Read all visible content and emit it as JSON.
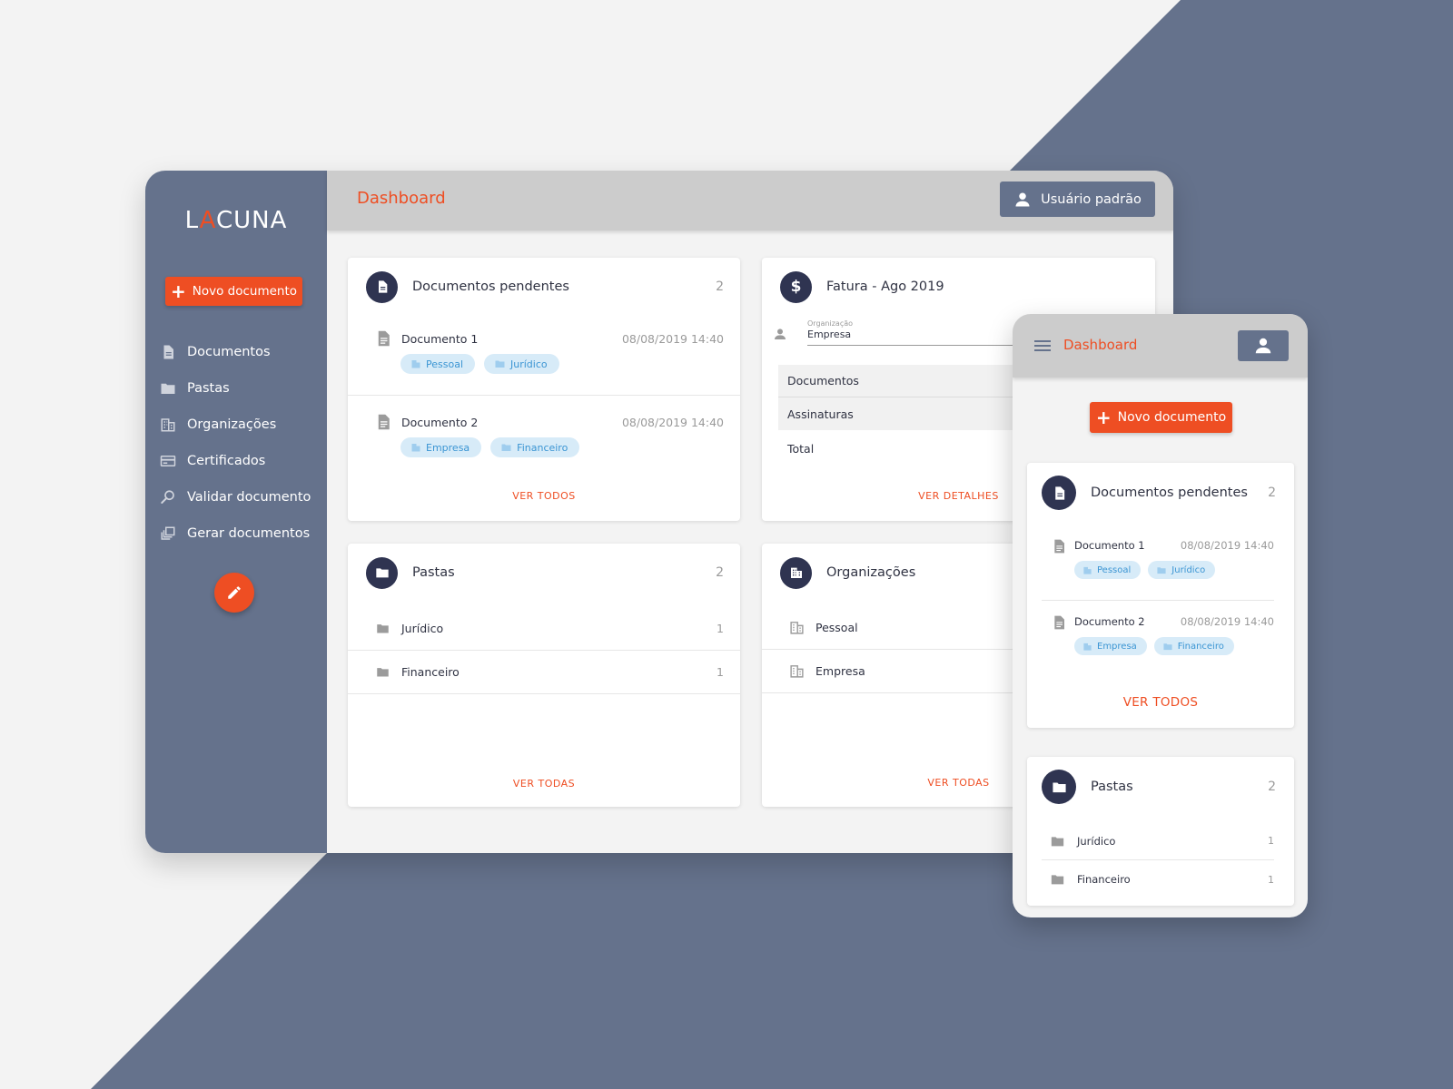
{
  "app": {
    "logo_prefix": "L",
    "logo_mark": "A",
    "logo_suffix": "CUNA"
  },
  "colors": {
    "accent": "#ee4e23",
    "sidebar": "#65728c",
    "dark_circle": "#2f3451",
    "chip_bg": "#d7ebf8",
    "chip_text": "#3b95d3",
    "page_bg": "#f3f3f3"
  },
  "sidebar": {
    "new_button": "Novo documento",
    "items": [
      {
        "label": "Documentos",
        "icon": "file-icon"
      },
      {
        "label": "Pastas",
        "icon": "folder-icon"
      },
      {
        "label": "Organizações",
        "icon": "building-icon"
      },
      {
        "label": "Certificados",
        "icon": "card-icon"
      },
      {
        "label": "Validar documento",
        "icon": "search-icon"
      },
      {
        "label": "Gerar documentos",
        "icon": "stack-icon"
      }
    ],
    "fab_icon": "pencil-icon"
  },
  "header": {
    "title": "Dashboard",
    "user_label": "Usuário padrão"
  },
  "pending": {
    "title": "Documentos pendentes",
    "count": "2",
    "link": "VER TODOS",
    "docs": [
      {
        "name": "Documento 1",
        "date": "08/08/2019 14:40",
        "chips": [
          {
            "label": "Pessoal",
            "icon": "building-icon"
          },
          {
            "label": "Jurídico",
            "icon": "folder-icon"
          }
        ]
      },
      {
        "name": "Documento 2",
        "date": "08/08/2019 14:40",
        "chips": [
          {
            "label": "Empresa",
            "icon": "building-icon"
          },
          {
            "label": "Financeiro",
            "icon": "folder-icon"
          }
        ]
      }
    ]
  },
  "invoice": {
    "title": "Fatura - Ago 2019",
    "org_label": "Organização",
    "org_value": "Empresa",
    "rows": [
      "Documentos",
      "Assinaturas",
      "Total"
    ],
    "link": "VER DETALHES"
  },
  "folders": {
    "title": "Pastas",
    "count": "2",
    "link": "VER TODAS",
    "items": [
      {
        "label": "Jurídico",
        "count": "1"
      },
      {
        "label": "Financeiro",
        "count": "1"
      }
    ]
  },
  "orgs": {
    "title": "Organizações",
    "link": "VER TODAS",
    "items": [
      {
        "label": "Pessoal"
      },
      {
        "label": "Empresa"
      }
    ]
  },
  "mobile": {
    "title": "Dashboard",
    "new_button": "Novo documento",
    "pending": {
      "title": "Documentos pendentes",
      "count": "2",
      "link": "VER TODOS",
      "docs": [
        {
          "name": "Documento 1",
          "date": "08/08/2019 14:40",
          "chips": [
            "Pessoal",
            "Jurídico"
          ]
        },
        {
          "name": "Documento 2",
          "date": "08/08/2019 14:40",
          "chips": [
            "Empresa",
            "Financeiro"
          ]
        }
      ]
    },
    "folders": {
      "title": "Pastas",
      "count": "2",
      "items": [
        {
          "label": "Jurídico",
          "count": "1"
        },
        {
          "label": "Financeiro",
          "count": "1"
        }
      ]
    }
  }
}
